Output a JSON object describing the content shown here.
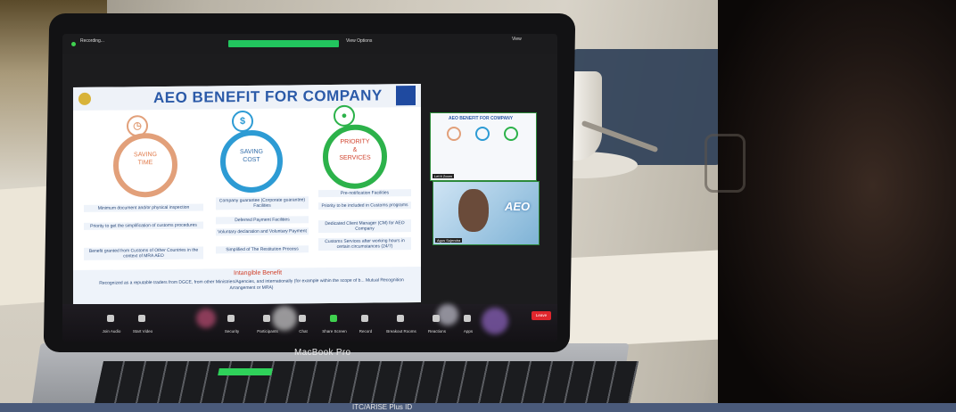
{
  "zoom": {
    "recording_label": "Recording...",
    "view_options": "View Options",
    "view_label": "View",
    "leave_label": "Leave"
  },
  "slide": {
    "title": "AEO BENEFIT FOR COMPANY",
    "columns": [
      {
        "label_1": "SAVING",
        "label_2": "TIME",
        "color": "#e2a07a",
        "items": [
          "Minimum document and/or physical inspection",
          "Priority to get the simplification of customs procedures",
          "Benefit granted from Customs of Other Countries in the context of MRA AEO"
        ]
      },
      {
        "label_1": "SAVING",
        "label_2": "COST",
        "color": "#2d9bd4",
        "items": [
          "Company guarantee (Corporate guarantee) Facilities",
          "Deferred Payment Facilities",
          "Voluntary declaration and Voluntary Payment",
          "Simplified of The Restitution Process"
        ]
      },
      {
        "label_1": "PRIORITY",
        "label_amp": "&",
        "label_2": "SERVICES",
        "color": "#2cb24a",
        "items": [
          "Pre-notification Facilities",
          "Priority to be included in Customs programs",
          "Dedicated Client Manager (CM) for AEO Company",
          "Customs Services after working hours in certain circumstances (24/7)"
        ]
      }
    ],
    "intangible_title": "Intangible Benefit",
    "intangible_text": "Recognized as a reputable traders from DGCE, from other Ministries/Agencies, and internationally (for example within the scope of b... Mutual Recognition Arrangement or MRA)"
  },
  "thumbnail": {
    "title": "AEO BENEFIT FOR COMPANY",
    "label": "Let it Zoom"
  },
  "video": {
    "name": "Agus Sujendra",
    "logo_text": "AEO"
  },
  "toolbar": {
    "items": [
      "Join Audio",
      "Start Video",
      "Security",
      "Participants",
      "Chat",
      "Share Screen",
      "Record",
      "Breakout Rooms",
      "Reactions",
      "Apps"
    ]
  },
  "device": {
    "brand": "MacBook Pro"
  },
  "banner": {
    "text": "ITC/ARISE Plus ID"
  }
}
